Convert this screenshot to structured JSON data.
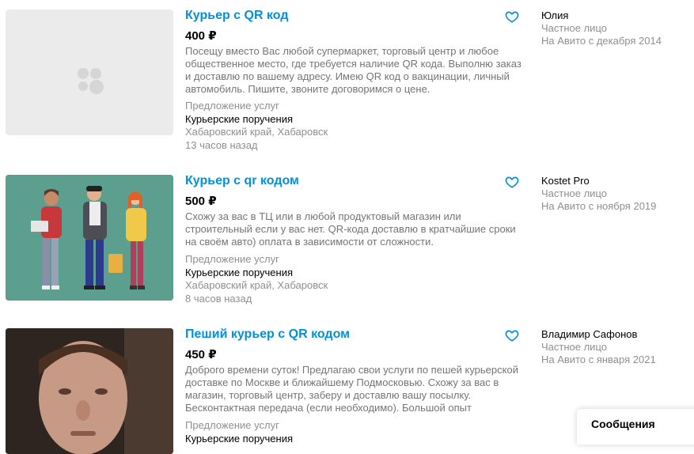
{
  "listings": [
    {
      "title": "Курьер с QR код",
      "price": "400 ₽",
      "description": "Посещу вместо Вас любой супермаркет, торговый центр и любое общественное место, где требуется наличие QR кода. Выполню заказ и доставлю по вашему адресу. Имею QR код о вакцинации, личный автомобиль. Пишите, звоните договоримся о цене.",
      "type": "Предложение услуг",
      "category": "Курьерские поручения",
      "location": "Хабаровский край, Хабаровск",
      "time": "13 часов назад",
      "seller_name": "Юлия",
      "seller_type": "Частное лицо",
      "seller_since": "На Авито с декабря 2014",
      "photo": "placeholder-icon"
    },
    {
      "title": "Курьер с qr кодом",
      "price": "500 ₽",
      "description": "Схожу за вас в ТЦ или в любой продуктовый магазин или строительный если у вас нет. QR-кода доставлю в кратчайшие сроки на своём авто) оплата в зависимости от сложности.",
      "type": "Предложение услуг",
      "category": "Курьерские поручения",
      "location": "Хабаровский край, Хабаровск",
      "time": "8 часов назад",
      "seller_name": "Kostet Pro",
      "seller_type": "Частное лицо",
      "seller_since": "На Авито с ноября 2019",
      "photo": "illustration-three-people"
    },
    {
      "title": "Пеший курьер с QR кодом",
      "price": "450 ₽",
      "description": "Доброго времени суток! Предлагаю свои услуги по пешей курьерской доставке по Москве и ближайшему Подмосковью. Схожу за вас в магазин, торговый центр, заберу и доставлю вашу посылку. Бесконтактная передача (если необходимо). Большой опыт курьерской",
      "type": "Предложение услуг",
      "category": "Курьерские поручения",
      "seller_name": "Владимир Сафонов",
      "seller_type": "Частное лицо",
      "seller_since": "На Авито с января 2021",
      "photo": "portrait-man"
    }
  ],
  "messages_label": "Сообщения",
  "colors": {
    "link": "#0091d9",
    "muted": "#8f8f8f",
    "desc": "#757575"
  }
}
